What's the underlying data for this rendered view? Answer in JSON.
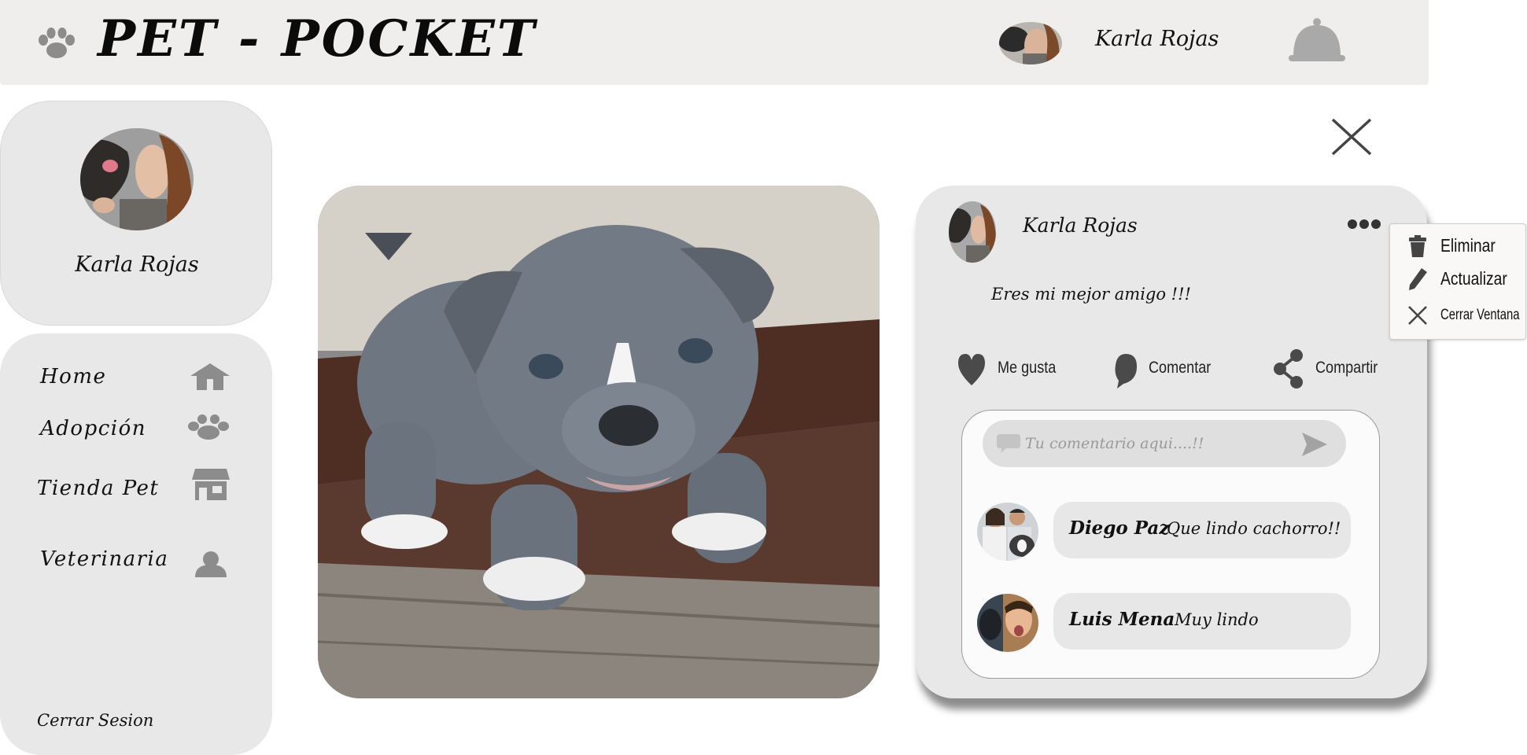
{
  "header": {
    "brand_title": "PET - POCKET",
    "user_name": "Karla Rojas",
    "icons": {
      "brand": "paw-icon",
      "notifications": "bell-icon"
    }
  },
  "sidebar": {
    "profile_name": "Karla Rojas",
    "nav": [
      {
        "label": "Home",
        "icon": "home-icon"
      },
      {
        "label": "Adopción",
        "icon": "paw-icon"
      },
      {
        "label": "Tienda Pet",
        "icon": "store-icon"
      },
      {
        "label": "Veterinaria",
        "icon": "vet-icon"
      }
    ],
    "logout_label": "Cerrar Sesion"
  },
  "post": {
    "author": "Karla Rojas",
    "text": "Eres mi mejor amigo !!!",
    "actions": {
      "like": "Me gusta",
      "comment": "Comentar",
      "share": "Compartir"
    },
    "comment_placeholder": "Tu comentario aqui....!!",
    "comments": [
      {
        "author": "Diego Paz",
        "text": "Que lindo cachorro!!"
      },
      {
        "author": "Luis Mena",
        "text": "Muy lindo"
      }
    ]
  },
  "options_menu": {
    "items": [
      {
        "label": "Eliminar",
        "icon": "trash-icon"
      },
      {
        "label": "Actualizar",
        "icon": "pencil-icon"
      },
      {
        "label": "Cerrar Ventana",
        "icon": "close-icon"
      }
    ]
  },
  "colors": {
    "header_bg": "#efeeec",
    "card_bg": "#e8e8e8",
    "icon_gray": "#8c8c8c",
    "text": "#111111"
  }
}
